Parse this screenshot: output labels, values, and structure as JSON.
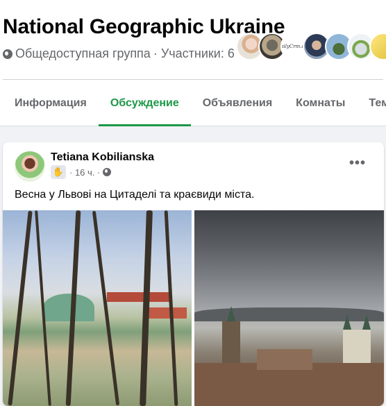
{
  "group": {
    "title": "National Geographic Ukraine",
    "privacy": "Общедоступная группа",
    "members_label": "· Участники: 6",
    "avatar_text": "DailyCrm.com"
  },
  "tabs": [
    {
      "label": "Информация",
      "active": false
    },
    {
      "label": "Обсуждение",
      "active": true
    },
    {
      "label": "Объявления",
      "active": false
    },
    {
      "label": "Комнаты",
      "active": false
    },
    {
      "label": "Тем",
      "active": false
    }
  ],
  "post": {
    "author": "Tetiana Kobilianska",
    "time": "· 16 ч. ·",
    "text": "Весна у Львові на Цитаделі та краєвиди міста.",
    "more": "•••"
  },
  "icons": {
    "globe": "globe-icon",
    "badge": "wave-hand-icon",
    "more": "more-options-icon"
  },
  "colors": {
    "accent": "#1c9846",
    "text_secondary": "#65676b",
    "background": "#f0f2f5"
  }
}
